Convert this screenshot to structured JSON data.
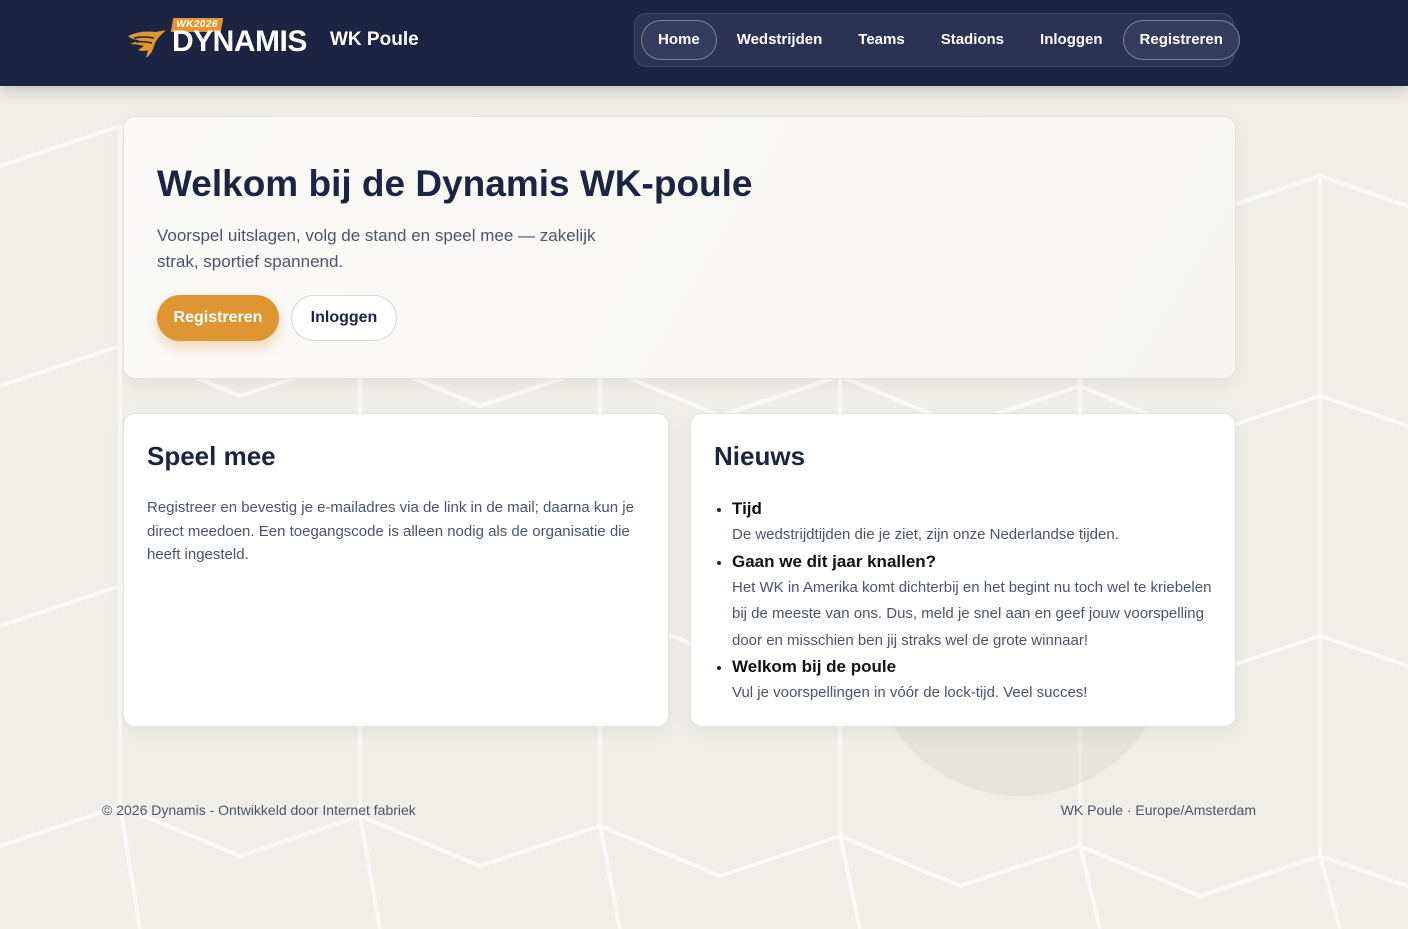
{
  "header": {
    "logo_badge": "WK2026",
    "logo_word": "DYNAMIS",
    "site_title": "WK Poule",
    "nav": [
      {
        "label": "Home"
      },
      {
        "label": "Wedstrijden"
      },
      {
        "label": "Teams"
      },
      {
        "label": "Stadions"
      },
      {
        "label": "Inloggen"
      },
      {
        "label": "Registreren"
      }
    ]
  },
  "hero": {
    "title": "Welkom bij de Dynamis WK-poule",
    "subtitle": "Voorspel uitslagen, volg de stand en speel mee — zakelijk strak, sportief spannend.",
    "primary_button": "Registreren",
    "secondary_button": "Inloggen"
  },
  "speel_mee": {
    "title": "Speel mee",
    "text": "Registreer en bevestig je e-mailadres via de link in de mail; daarna kun je direct meedoen. Een toegangscode is alleen nodig als de organisatie die heeft ingesteld."
  },
  "nieuws": {
    "title": "Nieuws",
    "items": [
      {
        "title": "Tijd",
        "body": "De wedstrijdtijden die je ziet, zijn onze Nederlandse tijden."
      },
      {
        "title": "Gaan we dit jaar knallen?",
        "body": "Het WK in Amerika komt dichterbij en het begint nu toch wel te kriebelen bij de meeste van ons. Dus, meld je snel aan en geef jouw voorspelling door en misschien ben jij straks wel de grote winnaar!"
      },
      {
        "title": "Welkom bij de poule",
        "body": "Vul je voorspellingen in vóór de lock-tijd. Veel succes!"
      }
    ]
  },
  "footer": {
    "left": "© 2026 Dynamis - Ontwikkeld door Internet fabriek",
    "right": "WK Poule · Europe/Amsterdam"
  },
  "colors": {
    "navy": "#1c2444",
    "accent": "#de9633",
    "background": "#efeee9"
  }
}
